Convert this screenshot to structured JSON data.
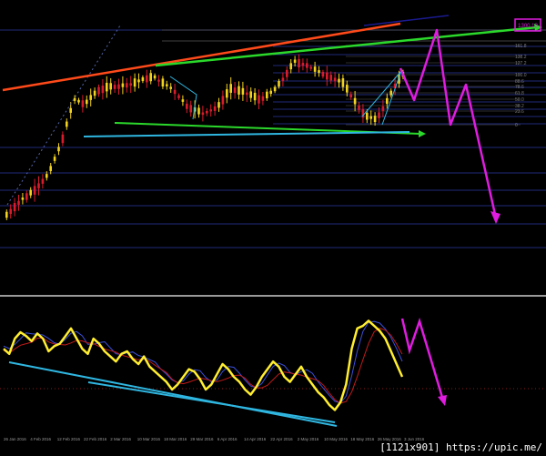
{
  "chart_data": {
    "type": "candlestick",
    "price_axis_badge": "1300.13",
    "fib_level_labels": [
      "161.8",
      "138.2",
      "127.2",
      "100.0",
      "88.6",
      "78.6",
      "61.8",
      "50.0",
      "38.2",
      "23.6",
      "0"
    ],
    "date_labels": [
      "26 Jan 2016",
      "4 Feb 2016",
      "12 Feb 2016",
      "22 Feb 2016",
      "2 Mar 2016",
      "10 Mar 2016",
      "18 Mar 2016",
      "29 Mar 2016",
      "6 Apr 2016",
      "14 Apr 2016",
      "22 Apr 2016",
      "2 May 2016",
      "10 May 2016",
      "18 May 2016",
      "26 May 2016",
      "3 Jun 2016"
    ],
    "oscillator": {
      "name": "stochastic",
      "main": [
        62,
        58,
        70,
        75,
        72,
        68,
        74,
        70,
        60,
        64,
        66,
        72,
        78,
        70,
        62,
        58,
        70,
        66,
        60,
        56,
        52,
        58,
        60,
        54,
        50,
        56,
        48,
        44,
        40,
        36,
        30,
        34,
        40,
        46,
        44,
        38,
        30,
        34,
        42,
        50,
        46,
        40,
        36,
        30,
        26,
        32,
        40,
        46,
        52,
        48,
        40,
        36,
        42,
        48,
        40,
        34,
        28,
        24,
        18,
        14,
        20,
        34,
        62,
        78,
        80,
        84,
        80,
        76,
        70,
        60,
        50,
        40
      ]
    }
  },
  "watermark": "[1121x901] https://upic.me/"
}
